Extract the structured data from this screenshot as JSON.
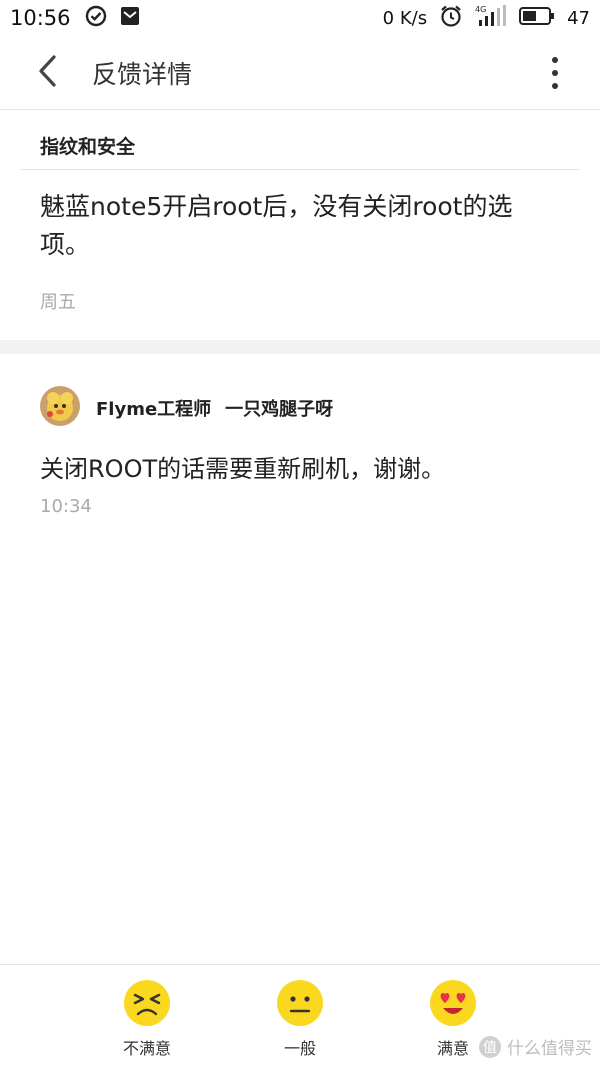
{
  "status_bar": {
    "time": "10:56",
    "speed": "0 K/s",
    "network": "4G",
    "battery": "47"
  },
  "header": {
    "title": "反馈详情"
  },
  "feedback": {
    "category": "指纹和安全",
    "content": "魅蓝note5开启root后，没有关闭root的选项。",
    "date": "周五"
  },
  "reply": {
    "author": "Flyme工程师",
    "nickname": "一只鸡腿子呀",
    "content": "关闭ROOT的话需要重新刷机，谢谢。",
    "time": "10:34"
  },
  "rating": {
    "options": [
      {
        "label": "不满意",
        "icon": "unsatisfied-face-icon"
      },
      {
        "label": "一般",
        "icon": "neutral-face-icon"
      },
      {
        "label": "满意",
        "icon": "satisfied-face-icon"
      }
    ],
    "face_color": "#f9d81f"
  },
  "watermark": {
    "text": "什么值得买",
    "mark": "值"
  }
}
